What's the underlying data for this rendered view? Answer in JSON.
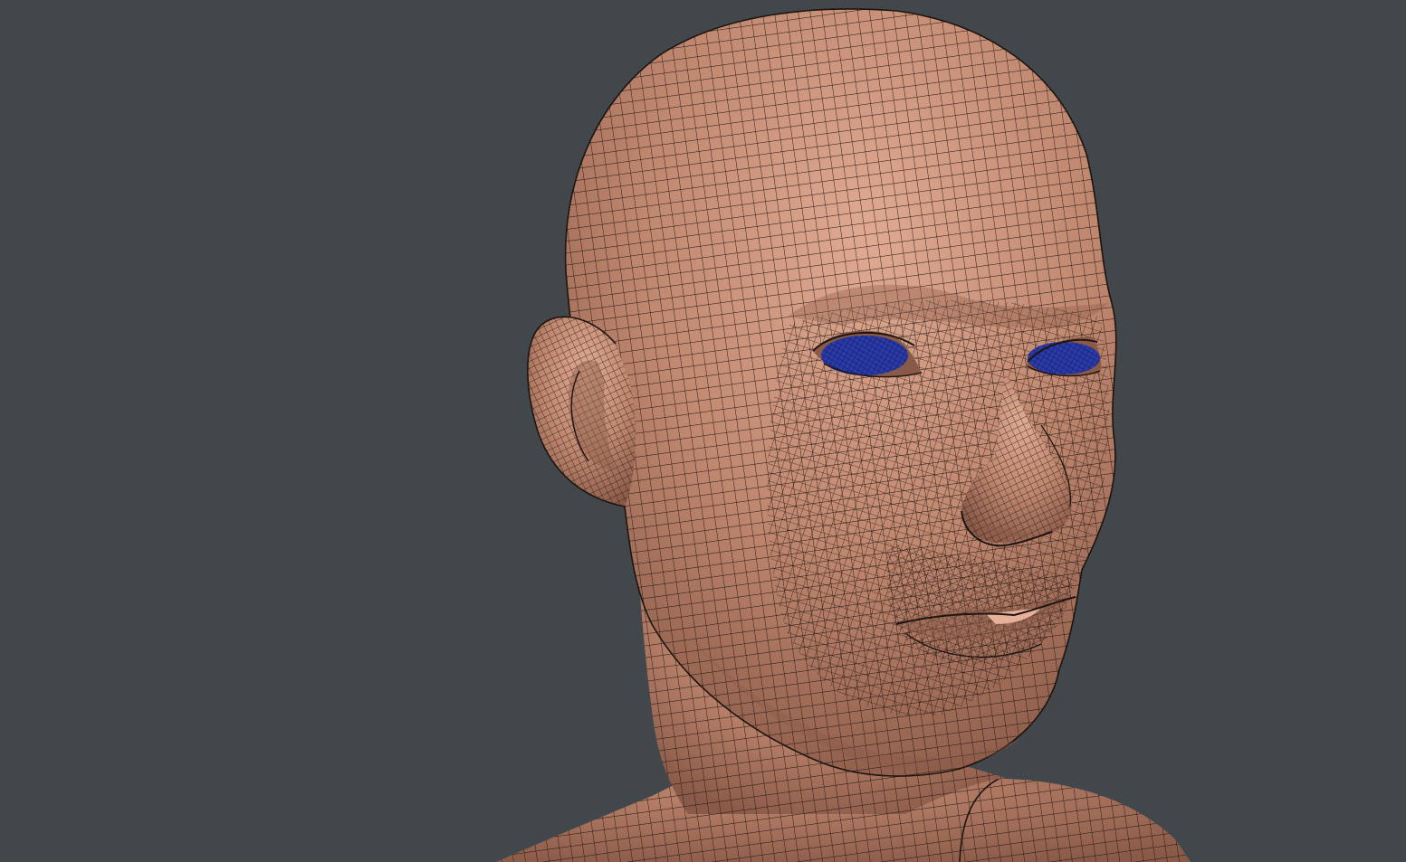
{
  "viewport": {
    "background_color": "#42474b",
    "model": {
      "subject": "head-bust",
      "display_mode": "shaded-with-wireframe",
      "skin_color": "#c0876f",
      "skin_highlight_color": "#e0aa92",
      "skin_shadow_color": "#8a5a48",
      "wire_color": "#1e1410",
      "eye_color": "#2a3aa8",
      "eye_wire_color": "#0b1240",
      "lip_inner_color": "#e7b09a"
    }
  }
}
